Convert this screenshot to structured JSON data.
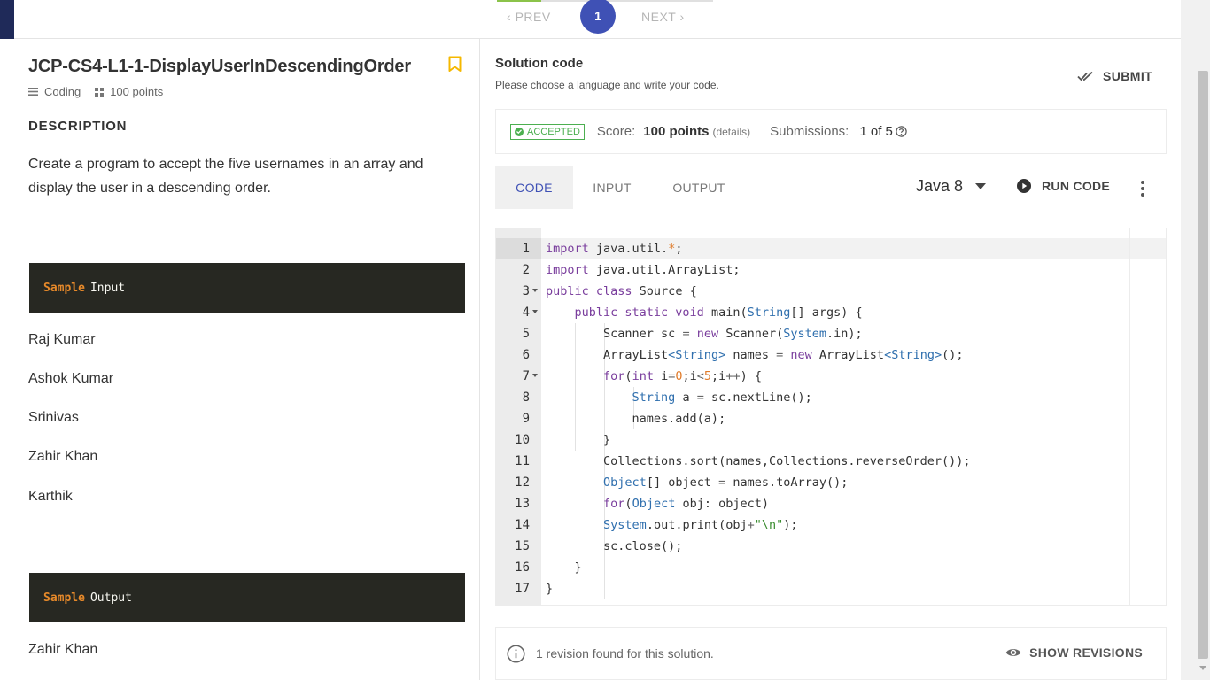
{
  "pager": {
    "prev_label": "PREV",
    "next_label": "NEXT",
    "current_page": "1"
  },
  "problem": {
    "title": "JCP-CS4-L1-1-DisplayUserInDescendingOrder",
    "type_label": "Coding",
    "points_label": "100 points",
    "description_heading": "DESCRIPTION",
    "description_text": "Create a program to accept the five usernames in an array and display the user in a descending order.",
    "sample_input": {
      "keyword": "Sample",
      "label": "Input",
      "lines": [
        "Raj Kumar",
        "Ashok Kumar",
        "Srinivas",
        "Zahir Khan",
        "Karthik"
      ]
    },
    "sample_output": {
      "keyword": "Sample",
      "label": "Output",
      "lines": [
        "Zahir Khan"
      ]
    }
  },
  "solution": {
    "title": "Solution code",
    "subtitle": "Please choose a language and write your code.",
    "submit_label": "SUBMIT",
    "status": {
      "badge": "ACCEPTED",
      "score_label": "Score:",
      "score_value": "100 points",
      "details_label": "(details)",
      "submissions_label": "Submissions:",
      "submissions_value": "1 of 5"
    },
    "tabs": [
      {
        "label": "CODE"
      },
      {
        "label": "INPUT"
      },
      {
        "label": "OUTPUT"
      }
    ],
    "language": "Java 8",
    "run_label": "RUN CODE",
    "revision_text": "1 revision found for this solution.",
    "show_revisions_label": "SHOW REVISIONS"
  },
  "code": {
    "lines": [
      {
        "n": "1",
        "tokens": [
          [
            "k",
            "import"
          ],
          [
            "p",
            " java.util."
          ],
          [
            "n",
            "*"
          ],
          [
            "p",
            ";"
          ]
        ]
      },
      {
        "n": "2",
        "tokens": [
          [
            "k",
            "import"
          ],
          [
            "p",
            " java.util.ArrayList;"
          ]
        ]
      },
      {
        "n": "3",
        "fold": true,
        "tokens": [
          [
            "k",
            "public class"
          ],
          [
            "p",
            " Source {"
          ]
        ]
      },
      {
        "n": "4",
        "fold": true,
        "tokens": [
          [
            "p",
            "    "
          ],
          [
            "k",
            "public static void"
          ],
          [
            "p",
            " main("
          ],
          [
            "t",
            "String"
          ],
          [
            "p",
            "[] args) {"
          ]
        ]
      },
      {
        "n": "5",
        "tokens": [
          [
            "p",
            "        Scanner sc "
          ],
          [
            "o",
            "="
          ],
          [
            "p",
            " "
          ],
          [
            "k",
            "new"
          ],
          [
            "p",
            " Scanner("
          ],
          [
            "t",
            "System"
          ],
          [
            "p",
            ".in);"
          ]
        ]
      },
      {
        "n": "6",
        "tokens": [
          [
            "p",
            "        ArrayList"
          ],
          [
            "t",
            "<String>"
          ],
          [
            "p",
            " names "
          ],
          [
            "o",
            "="
          ],
          [
            "p",
            " "
          ],
          [
            "k",
            "new"
          ],
          [
            "p",
            " ArrayList"
          ],
          [
            "t",
            "<String>"
          ],
          [
            "p",
            "();"
          ]
        ]
      },
      {
        "n": "7",
        "fold": true,
        "tokens": [
          [
            "p",
            "        "
          ],
          [
            "k",
            "for"
          ],
          [
            "p",
            "("
          ],
          [
            "k",
            "int"
          ],
          [
            "p",
            " i"
          ],
          [
            "o",
            "="
          ],
          [
            "n",
            "0"
          ],
          [
            "p",
            ";i"
          ],
          [
            "o",
            "<"
          ],
          [
            "n",
            "5"
          ],
          [
            "p",
            ";i"
          ],
          [
            "o",
            "++"
          ],
          [
            "p",
            ") {"
          ]
        ]
      },
      {
        "n": "8",
        "tokens": [
          [
            "p",
            "            "
          ],
          [
            "t",
            "String"
          ],
          [
            "p",
            " a "
          ],
          [
            "o",
            "="
          ],
          [
            "p",
            " sc.nextLine();"
          ]
        ]
      },
      {
        "n": "9",
        "tokens": [
          [
            "p",
            "            names.add(a);"
          ]
        ]
      },
      {
        "n": "10",
        "tokens": [
          [
            "p",
            "        }"
          ]
        ]
      },
      {
        "n": "11",
        "tokens": [
          [
            "p",
            "        Collections.sort(names,Collections.reverseOrder());"
          ]
        ]
      },
      {
        "n": "12",
        "tokens": [
          [
            "p",
            "        "
          ],
          [
            "t",
            "Object"
          ],
          [
            "p",
            "[] object "
          ],
          [
            "o",
            "="
          ],
          [
            "p",
            " names.toArray();"
          ]
        ]
      },
      {
        "n": "13",
        "tokens": [
          [
            "p",
            "        "
          ],
          [
            "k",
            "for"
          ],
          [
            "p",
            "("
          ],
          [
            "t",
            "Object"
          ],
          [
            "p",
            " obj: object)"
          ]
        ]
      },
      {
        "n": "14",
        "tokens": [
          [
            "p",
            "        "
          ],
          [
            "t",
            "System"
          ],
          [
            "p",
            ".out.print(obj"
          ],
          [
            "o",
            "+"
          ],
          [
            "s",
            "\"\\n\""
          ],
          [
            "p",
            ");"
          ]
        ]
      },
      {
        "n": "15",
        "tokens": [
          [
            "p",
            "        sc.close();"
          ]
        ]
      },
      {
        "n": "16",
        "tokens": [
          [
            "p",
            "    }"
          ]
        ]
      },
      {
        "n": "17",
        "tokens": [
          [
            "p",
            "}"
          ]
        ]
      }
    ]
  },
  "colors": {
    "accent": "#3f51b5",
    "accepted": "#4caf50",
    "bookmark": "#f5b800",
    "sample_box_bg": "#272822",
    "sample_keyword": "#e6892a"
  }
}
